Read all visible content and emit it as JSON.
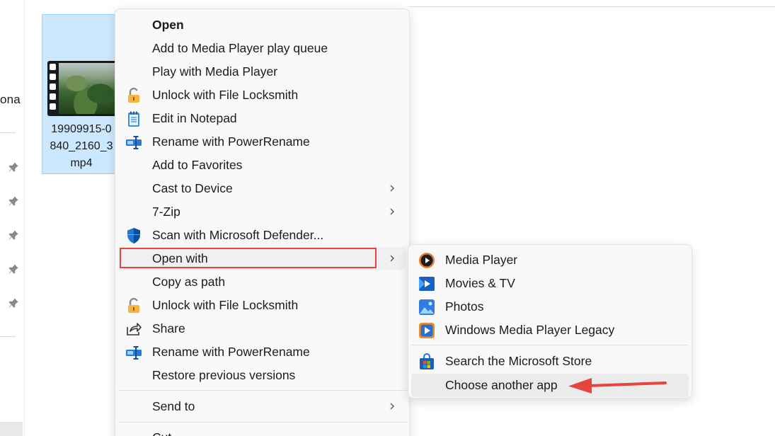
{
  "explorer": {
    "nav_partial_label": "ona",
    "file_name_lines": [
      "19909915-0",
      "840_2160_3",
      "mp4"
    ]
  },
  "context_menu": {
    "items": [
      {
        "label": "Open",
        "bold": true,
        "icon": ""
      },
      {
        "label": "Add to Media Player play queue",
        "icon": ""
      },
      {
        "label": "Play with Media Player",
        "icon": ""
      },
      {
        "label": "Unlock with File Locksmith",
        "icon": "padlock-icon"
      },
      {
        "label": "Edit in Notepad",
        "icon": "notepad-icon"
      },
      {
        "label": "Rename with PowerRename",
        "icon": "powerrename-icon"
      },
      {
        "label": "Add to Favorites",
        "icon": ""
      },
      {
        "label": "Cast to Device",
        "icon": "",
        "submenu": true
      },
      {
        "label": "7-Zip",
        "icon": "",
        "submenu": true
      },
      {
        "label": "Scan with Microsoft Defender...",
        "icon": "defender-shield-icon"
      },
      {
        "label": "Open with",
        "icon": "",
        "submenu": true,
        "highlighted": true
      },
      {
        "label": "Copy as path",
        "icon": ""
      },
      {
        "label": "Unlock with File Locksmith",
        "icon": "padlock-icon"
      },
      {
        "label": "Share",
        "icon": "share-icon"
      },
      {
        "label": "Rename with PowerRename",
        "icon": "powerrename-icon"
      },
      {
        "label": "Restore previous versions",
        "icon": ""
      },
      {
        "label": "Send to",
        "icon": "",
        "submenu": true
      },
      {
        "label": "Cut",
        "icon": ""
      }
    ]
  },
  "open_with_submenu": {
    "items": [
      {
        "label": "Media Player",
        "icon": "media-player-icon"
      },
      {
        "label": "Movies & TV",
        "icon": "movies-tv-icon"
      },
      {
        "label": "Photos",
        "icon": "photos-icon"
      },
      {
        "label": "Windows Media Player Legacy",
        "icon": "wmp-legacy-icon"
      },
      {
        "label": "Search the Microsoft Store",
        "icon": "microsoft-store-icon"
      },
      {
        "label": "Choose another app",
        "icon": "",
        "hovered": true
      }
    ]
  },
  "colors": {
    "highlight_box": "#e5453c",
    "selection_fill": "#cce8ff",
    "menu_bg": "#f9f9f9"
  }
}
